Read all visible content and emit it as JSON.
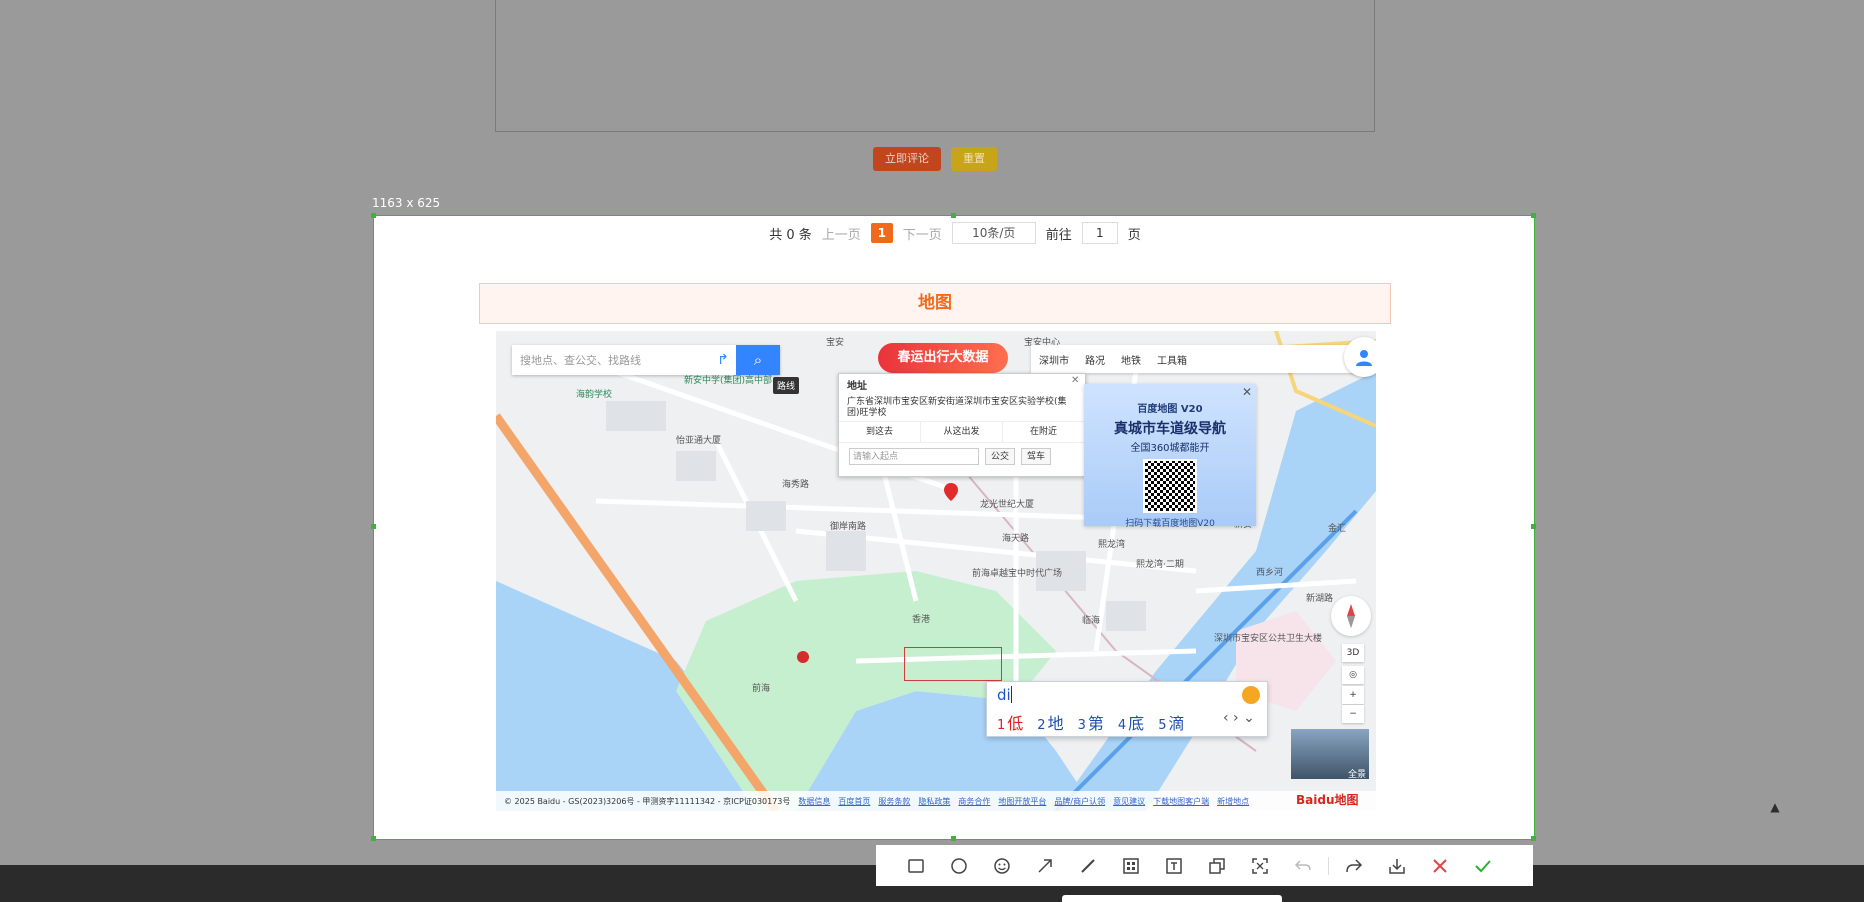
{
  "background_page": {
    "submit_button": "立即评论",
    "reset_button": "重置"
  },
  "capture": {
    "size_label": "1163 x 625"
  },
  "pagination": {
    "total": "共 0 条",
    "prev": "上一页",
    "current": "1",
    "next": "下一页",
    "page_size": "10条/页",
    "goto_label": "前往",
    "goto_value": "1",
    "page_suffix": "页"
  },
  "map_section": {
    "title": "地图"
  },
  "map": {
    "search_placeholder": "搜地点、查公交、找路线",
    "route_tooltip": "路线",
    "banner": "春运出行大数据",
    "city_bar": [
      "深圳市",
      "路况",
      "地铁",
      "工具箱"
    ],
    "info_window": {
      "title": "地址",
      "address": "广东省深圳市宝安区新安街道深圳市宝安区实验学校(集团)旺学校",
      "tabs": [
        "到这去",
        "从这出发",
        "在附近"
      ],
      "start_placeholder": "请输入起点",
      "bus_button": "公交",
      "drive_button": "驾车"
    },
    "promo": {
      "brand": "百度地图 V20",
      "headline": "真城市车道级导航",
      "subline": "全国360城都能开",
      "scan_text": "扫码下载百度地图V20"
    },
    "controls": {
      "three_d": "3D",
      "zoom_in": "+",
      "zoom_out": "−",
      "pano_label": "全景"
    },
    "pois": [
      "宝安",
      "宝安中心",
      "新安中学(集团)高中部",
      "海韵学校",
      "怡亚通大厦",
      "海秀路",
      "龙光世纪大厦",
      "御岸南路",
      "海天路",
      "前海卓越宝中时代广场",
      "熙龙湾",
      "熙龙湾·二期",
      "新安",
      "深圳市宝安区公共卫生大楼",
      "临海",
      "西乡河",
      "香港",
      "新湖路",
      "前海",
      "金汇"
    ],
    "footer": {
      "copyright": "© 2025 Baidu - GS(2023)3206号 - 甲测资字11111342 - 京ICP证030173号",
      "links": [
        "数据信息",
        "百度首页",
        "服务条款",
        "隐私政策",
        "商务合作",
        "地图开放平台",
        "品牌/商户认领",
        "意见建议",
        "下载地图客户端",
        "新增地点"
      ],
      "logo": "Baidu地图"
    }
  },
  "ime": {
    "composition": "di",
    "candidates": [
      {
        "num": "1",
        "char": "低"
      },
      {
        "num": "2",
        "char": "地"
      },
      {
        "num": "3",
        "char": "第"
      },
      {
        "num": "4",
        "char": "底"
      },
      {
        "num": "5",
        "char": "滴"
      }
    ]
  },
  "toolbar": {
    "tools": [
      "rectangle-icon",
      "ellipse-icon",
      "emoji-icon",
      "arrow-icon",
      "line-icon",
      "mosaic-icon",
      "text-icon",
      "copy-icon",
      "ocr-icon",
      "undo-icon",
      "share-icon",
      "save-icon",
      "cancel-icon",
      "confirm-icon"
    ],
    "accent": "#3db33d",
    "cancel_color": "#e34343",
    "confirm_color": "#2db12d"
  },
  "scroll_top_icon": "▲"
}
